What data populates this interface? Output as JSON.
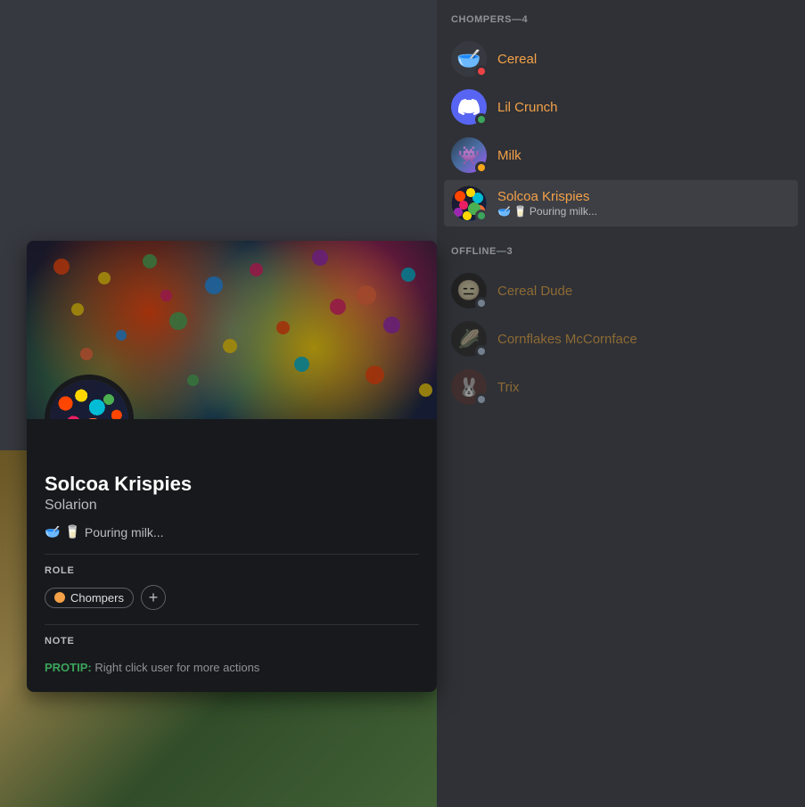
{
  "leftPanel": {
    "background": "#36393f"
  },
  "rightPanel": {
    "sections": [
      {
        "id": "online",
        "label": "CHOMPERS—4",
        "members": [
          {
            "id": "cereal",
            "name": "Cereal",
            "status": "dnd",
            "avatarType": "cereal",
            "avatarEmoji": "🥣",
            "activity": null
          },
          {
            "id": "lil-crunch",
            "name": "Lil Crunch",
            "status": "online",
            "avatarType": "discord",
            "avatarEmoji": "💬",
            "activity": null
          },
          {
            "id": "milk",
            "name": "Milk",
            "status": "idle",
            "avatarType": "alien",
            "avatarEmoji": "👾",
            "activity": null
          },
          {
            "id": "solcoa-krispies",
            "name": "Solcoa Krispies",
            "status": "online",
            "avatarType": "solcoa",
            "avatarEmoji": "🥣",
            "activity": "🥣 🥛 Pouring milk...",
            "active": true
          }
        ]
      },
      {
        "id": "offline",
        "label": "OFFLINE—3",
        "members": [
          {
            "id": "cereal-dude",
            "name": "Cereal Dude",
            "status": "offline",
            "avatarType": "dark",
            "avatarEmoji": "😑",
            "activity": null
          },
          {
            "id": "cornflakes-mccornface",
            "name": "Cornflakes McCornface",
            "status": "offline",
            "avatarType": "cornflakes",
            "avatarEmoji": "🌽",
            "activity": null
          },
          {
            "id": "trix",
            "name": "Trix",
            "status": "offline",
            "avatarType": "trix",
            "avatarEmoji": "🐰",
            "activity": null
          }
        ]
      }
    ]
  },
  "profilePopup": {
    "username": "Solcoa Krispies",
    "discriminator": "Solarion",
    "activity": "🥣 🥛 Pouring milk...",
    "status": "online",
    "roleLabel": "ROLE",
    "roleName": "Chompers",
    "roleColor": "#f4a148",
    "noteLabel": "NOTE",
    "protipLabel": "PROTIP:",
    "protipText": "Right click user for more actions",
    "addRoleLabel": "+"
  }
}
